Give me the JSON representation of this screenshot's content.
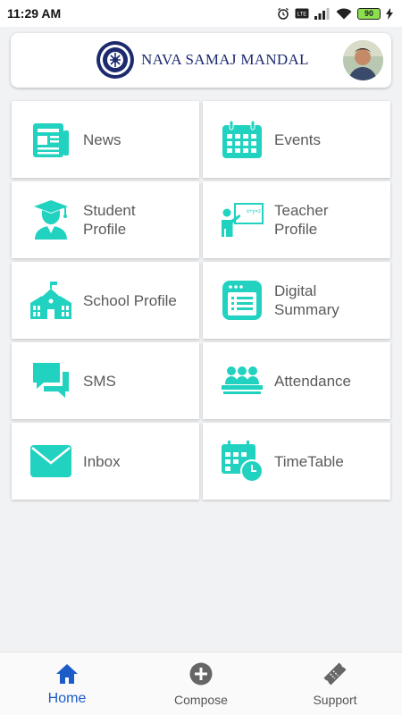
{
  "status_bar": {
    "time": "11:29 AM",
    "battery": "90"
  },
  "header": {
    "title": "NAVA SAMAJ MANDAL"
  },
  "tiles": [
    {
      "label": "News",
      "icon": "news-icon"
    },
    {
      "label": "Events",
      "icon": "calendar-icon"
    },
    {
      "label": "Student\nProfile",
      "icon": "student-icon"
    },
    {
      "label": "Teacher\nProfile",
      "icon": "teacher-icon"
    },
    {
      "label": "School Profile",
      "icon": "school-icon"
    },
    {
      "label": "Digital\nSummary",
      "icon": "summary-icon"
    },
    {
      "label": "SMS",
      "icon": "chat-icon"
    },
    {
      "label": "Attendance",
      "icon": "attendance-icon"
    },
    {
      "label": "Inbox",
      "icon": "mail-icon"
    },
    {
      "label": "TimeTable",
      "icon": "timetable-icon"
    }
  ],
  "bottom_nav": {
    "home": "Home",
    "compose": "Compose",
    "support": "Support"
  },
  "colors": {
    "accent": "#21d2c0",
    "active": "#1b5cc9",
    "brand": "#1c2a6e"
  }
}
